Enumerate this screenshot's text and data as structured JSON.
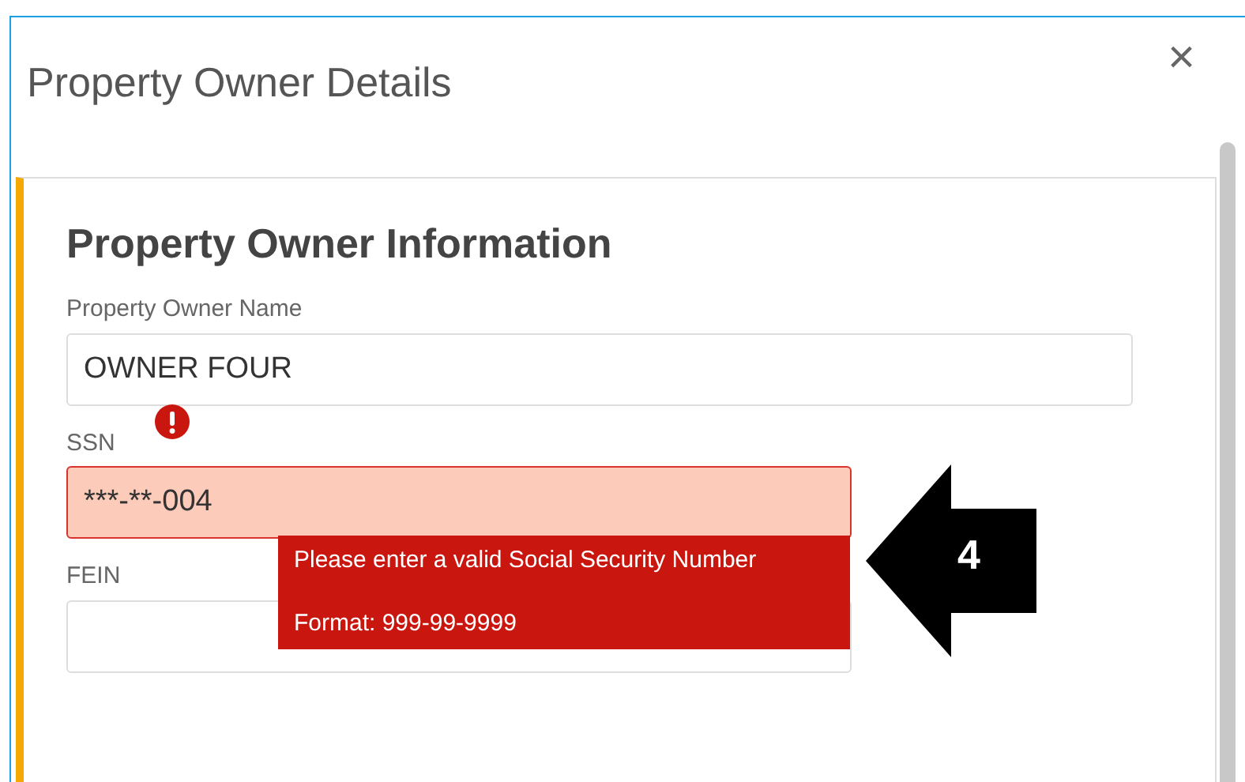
{
  "dialog": {
    "title": "Property Owner Details",
    "close": "×"
  },
  "section": {
    "heading": "Property Owner Information",
    "fields": [
      {
        "label": "Property Owner Name",
        "value": "OWNER FOUR",
        "invalid": false
      },
      {
        "label": "SSN",
        "value": "***-**-004",
        "invalid": true,
        "error_lines": [
          "Please enter a valid Social Security Number",
          "Format: 999-99-9999"
        ]
      },
      {
        "label": "FEIN",
        "invalid": false
      }
    ]
  },
  "callout": {
    "number": "4"
  }
}
